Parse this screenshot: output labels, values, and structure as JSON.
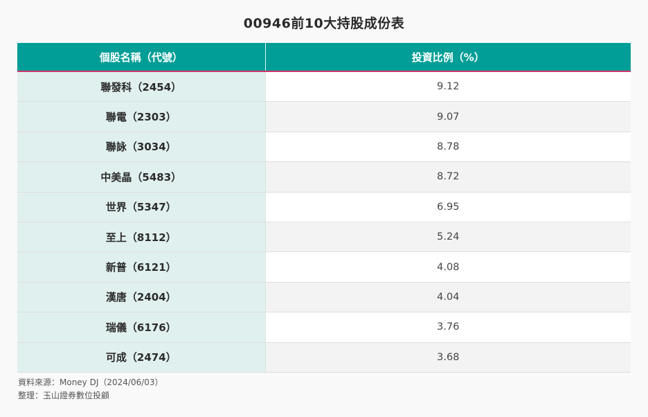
{
  "title": "00946前10大持股成份表",
  "table": {
    "headers": [
      "個股名稱（代號）",
      "投資比例（%）"
    ],
    "rows": [
      {
        "name": "聯發科（2454）",
        "ratio": "9.12"
      },
      {
        "name": "聯電（2303）",
        "ratio": "9.07"
      },
      {
        "name": "聯詠（3034）",
        "ratio": "8.78"
      },
      {
        "name": "中美晶（5483）",
        "ratio": "8.72"
      },
      {
        "name": "世界（5347）",
        "ratio": "6.95"
      },
      {
        "name": "至上（8112）",
        "ratio": "5.24"
      },
      {
        "name": "新普（6121）",
        "ratio": "4.08"
      },
      {
        "name": "漢唐（2404）",
        "ratio": "4.04"
      },
      {
        "name": "瑞儀（6176）",
        "ratio": "3.76"
      },
      {
        "name": "可成（2474）",
        "ratio": "3.68"
      }
    ]
  },
  "footer": {
    "source": "資料來源：Money DJ（2024/06/03）",
    "compiled_by": "整理：玉山證券數位投顧"
  },
  "colors": {
    "header_bg": "#009e96",
    "header_underline": "#d6336c",
    "name_col_bg": "#e0f0ef"
  }
}
